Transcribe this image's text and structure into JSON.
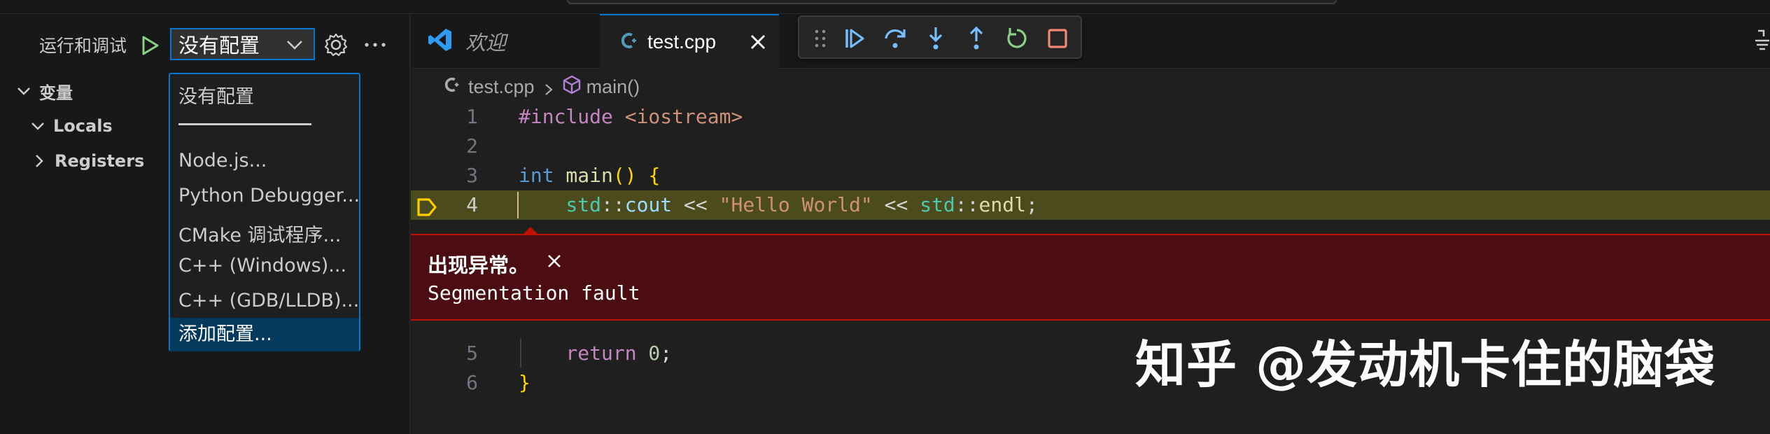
{
  "sidebar": {
    "title": "运行和调试",
    "config_selected": "没有配置",
    "tree": {
      "variables": "变量",
      "locals": "Locals",
      "registers": "Registers"
    },
    "dropdown": {
      "options": [
        "没有配置",
        "Node.js...",
        "Python Debugger...",
        "CMake 调试程序...",
        "C++ (Windows)...",
        "C++ (GDB/LLDB)...",
        "添加配置..."
      ]
    }
  },
  "tabs": {
    "welcome": "欢迎",
    "active": "test.cpp"
  },
  "breadcrumb": {
    "file": "test.cpp",
    "symbol": "main()"
  },
  "editor": {
    "line_numbers": [
      "1",
      "2",
      "3",
      "4",
      "5",
      "6"
    ],
    "code": {
      "l1_directive": "#include",
      "l1_header": " <iostream>",
      "l3_type": "int",
      "l3_fn": " main",
      "l3_parens": "()",
      "l3_brace": " {",
      "l4_ns1": "    std",
      "l4_sep1": "::",
      "l4_cout": "cout",
      "l4_op1": " << ",
      "l4_str": "\"Hello World\"",
      "l4_op2": " << ",
      "l4_ns2": "std",
      "l4_sep2": "::",
      "l4_endl": "endl",
      "l4_semi": ";",
      "l5_ret": "    return",
      "l5_num": " 0",
      "l5_semi": ";",
      "l6_brace": "}"
    }
  },
  "exception": {
    "title": "出现异常。",
    "message": "Segmentation fault"
  },
  "watermark": "知乎 @发动机卡住的脑袋",
  "colors": {
    "accent": "#0078d4",
    "exception_bg": "#4b0d11",
    "current_line": "#4b4b1e",
    "debug_blue": "#75beff",
    "debug_green": "#89d185",
    "debug_red": "#f48771"
  }
}
